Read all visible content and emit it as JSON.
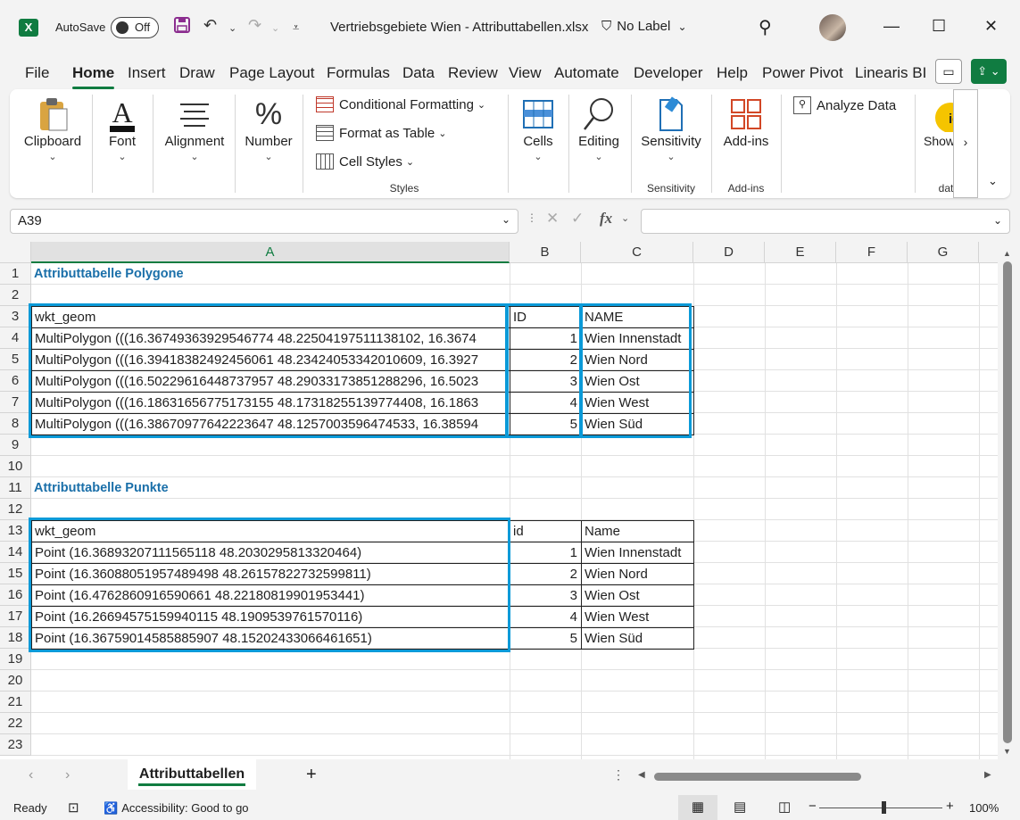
{
  "titlebar": {
    "autosave_label": "AutoSave",
    "autosave_state": "Off",
    "doc_title": "Vertriebsgebiete Wien - Attributtabellen.xlsx",
    "sensitivity_label": "No Label"
  },
  "menu": {
    "tabs": [
      "File",
      "Home",
      "Insert",
      "Draw",
      "Page Layout",
      "Formulas",
      "Data",
      "Review",
      "View",
      "Automate",
      "Developer",
      "Help",
      "Power Pivot",
      "Linearis BI"
    ],
    "active": "Home"
  },
  "ribbon": {
    "clipboard": "Clipboard",
    "font": "Font",
    "alignment": "Alignment",
    "number": "Number",
    "conditional_formatting": "Conditional Formatting",
    "format_as_table": "Format as Table",
    "cell_styles": "Cell Styles",
    "styles_group": "Styles",
    "cells": "Cells",
    "editing": "Editing",
    "sensitivity": "Sensitivity",
    "sensitivity_group": "Sensitivity",
    "addins": "Add-ins",
    "addins_group": "Add-ins",
    "analyze_data": "Analyze Data",
    "show_taskpane": "Show Taskpane",
    "data_group": "data"
  },
  "formula_bar": {
    "name_box": "A39",
    "fx": "fx",
    "formula": ""
  },
  "columns": [
    "A",
    "B",
    "C",
    "D",
    "E",
    "F",
    "G"
  ],
  "rows": [
    "1",
    "2",
    "3",
    "4",
    "5",
    "6",
    "7",
    "8",
    "9",
    "10",
    "11",
    "12",
    "13",
    "14",
    "15",
    "16",
    "17",
    "18",
    "19",
    "20",
    "21",
    "22",
    "23"
  ],
  "sheet": {
    "polygon_title": "Attributtabelle Polygone",
    "polygon_headers": [
      "wkt_geom",
      "ID",
      "NAME"
    ],
    "polygon_rows": [
      [
        "MultiPolygon (((16.36749363929546774 48.22504197511138102, 16.3674",
        "1",
        "Wien Innenstadt"
      ],
      [
        "MultiPolygon (((16.39418382492456061 48.23424053342010609, 16.3927",
        "2",
        "Wien Nord"
      ],
      [
        "MultiPolygon (((16.50229616448737957 48.29033173851288296, 16.5023",
        "3",
        "Wien Ost"
      ],
      [
        "MultiPolygon (((16.18631656775173155 48.17318255139774408, 16.1863",
        "4",
        "Wien West"
      ],
      [
        "MultiPolygon (((16.38670977642223647 48.1257003596474533, 16.38594",
        "5",
        "Wien Süd"
      ]
    ],
    "point_title": "Attributtabelle Punkte",
    "point_headers": [
      "wkt_geom",
      "id",
      "Name"
    ],
    "point_rows": [
      [
        "Point (16.36893207111565118 48.2030295813320464)",
        "1",
        "Wien Innenstadt"
      ],
      [
        "Point (16.36088051957489498 48.26157822732599811)",
        "2",
        "Wien Nord"
      ],
      [
        "Point (16.4762860916590661 48.22180819901953441)",
        "3",
        "Wien Ost"
      ],
      [
        "Point (16.26694575159940115 48.1909539761570116)",
        "4",
        "Wien West"
      ],
      [
        "Point (16.36759014585885907 48.15202433066461651)",
        "5",
        "Wien Süd"
      ]
    ]
  },
  "sheet_tabs": [
    "Attributtabellen"
  ],
  "status": {
    "ready": "Ready",
    "accessibility": "Accessibility: Good to go",
    "zoom": "100%"
  },
  "colors": {
    "accent": "#107c41",
    "highlight": "#0b9ad8",
    "title_text": "#1a6fa9"
  }
}
